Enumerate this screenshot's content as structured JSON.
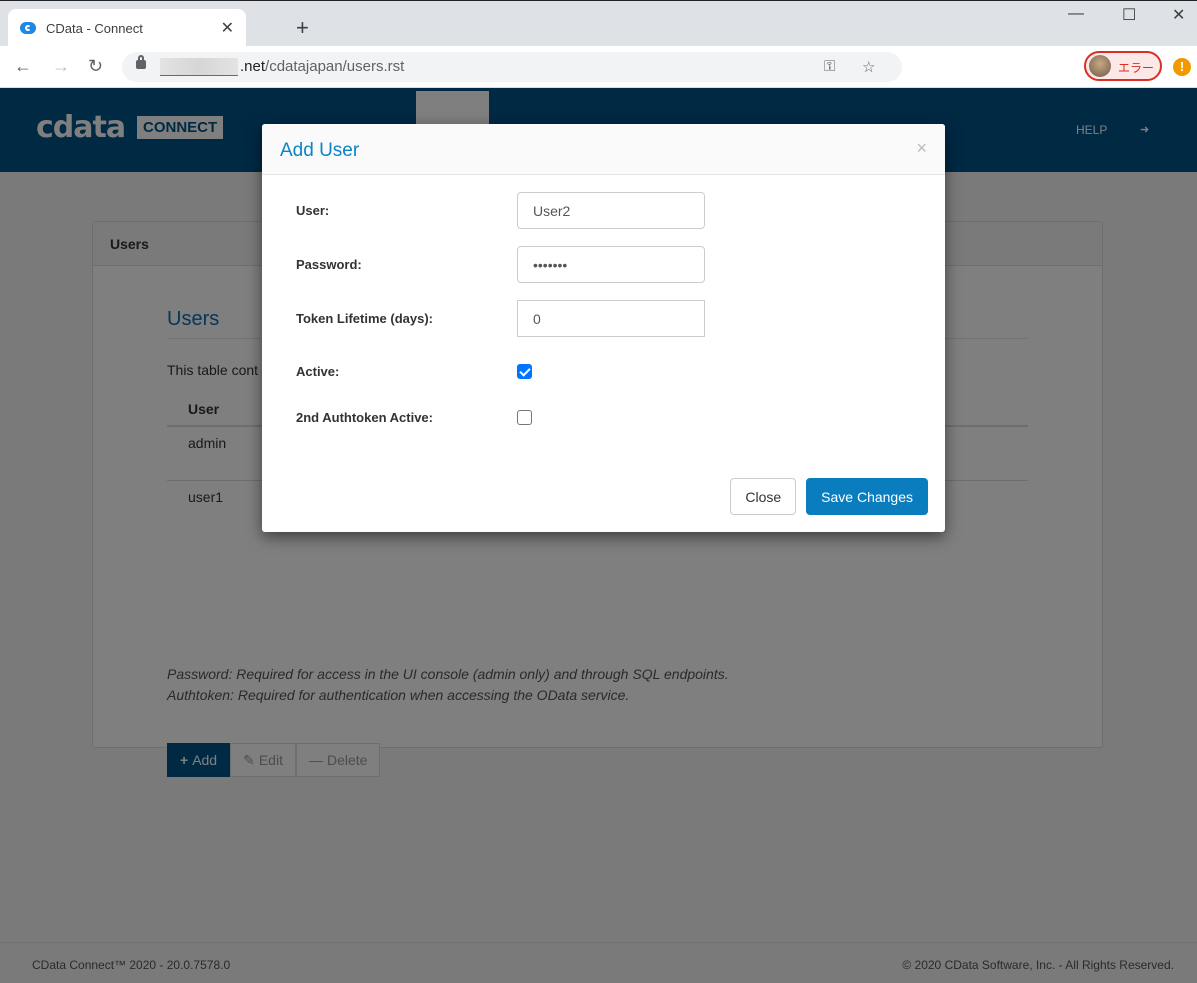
{
  "browser": {
    "tab_title": "CData - Connect",
    "tab_close": "✕",
    "new_tab": "+",
    "window_controls": {
      "minimize": "—",
      "maximize": "☐",
      "close": "✕"
    },
    "nav": {
      "back": "←",
      "forward": "→",
      "reload": "↻"
    },
    "url_domain_suffix": ".net",
    "url_path": "/cdatajapan/users.rst",
    "omnibox_icons": {
      "key": "⚿",
      "star": "☆"
    },
    "profile_label": "エラー",
    "alert": "!"
  },
  "app": {
    "logo_text": "cdata",
    "logo_badge": "CONNECT",
    "nav": {
      "help": "HELP",
      "logout_icon": "➜"
    },
    "panel_heading": "Users",
    "section_title": "Users",
    "description": "This table cont",
    "table": {
      "headers": [
        "User"
      ],
      "rows": [
        {
          "user": "admin"
        },
        {
          "user": "user1"
        }
      ]
    },
    "notes": [
      "Password: Required for access in the UI console (admin only) and through SQL endpoints.",
      "Authtoken: Required for authentication when accessing the OData service."
    ],
    "buttons": {
      "add": "Add",
      "add_icon": "+",
      "edit": "Edit",
      "edit_icon": "✎",
      "delete": "Delete",
      "delete_icon": "—"
    },
    "footer": {
      "left": "CData Connect™ 2020 - 20.0.7578.0",
      "right": "© 2020 CData Software, Inc. - All Rights Reserved."
    }
  },
  "modal": {
    "title": "Add User",
    "close_icon": "×",
    "fields": {
      "user": {
        "label": "User:",
        "value": "User2"
      },
      "password": {
        "label": "Password:",
        "value": "•••••••"
      },
      "token_lifetime": {
        "label": "Token Lifetime (days):",
        "value": "0"
      },
      "active": {
        "label": "Active:",
        "checked": true
      },
      "second_authtoken": {
        "label": "2nd Authtoken Active:",
        "checked": false
      }
    },
    "buttons": {
      "close": "Close",
      "save": "Save Changes"
    }
  }
}
